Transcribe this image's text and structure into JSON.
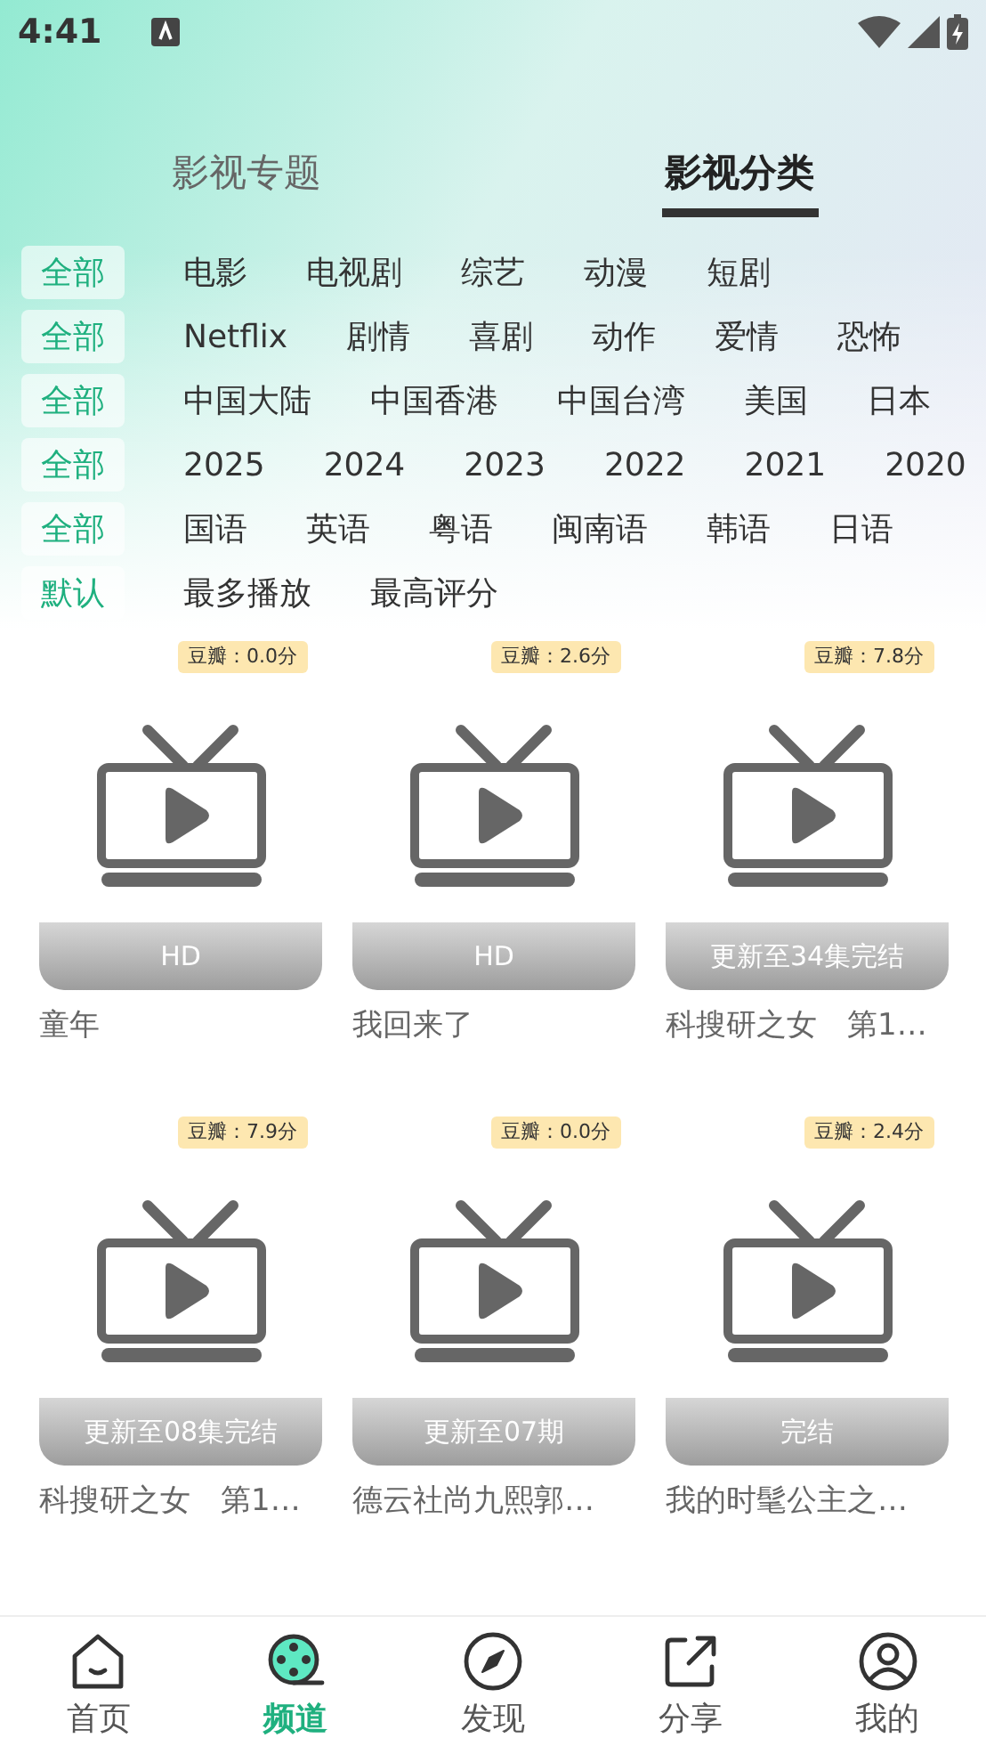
{
  "status_bar": {
    "time": "4:41"
  },
  "tabs": [
    {
      "label": "影视专题",
      "selected": false
    },
    {
      "label": "影视分类",
      "selected": true
    }
  ],
  "filters": [
    {
      "options": [
        {
          "label": "全部",
          "selected": true
        },
        {
          "label": "电影",
          "selected": false
        },
        {
          "label": "电视剧",
          "selected": false
        },
        {
          "label": "综艺",
          "selected": false
        },
        {
          "label": "动漫",
          "selected": false
        },
        {
          "label": "短剧",
          "selected": false
        }
      ]
    },
    {
      "options": [
        {
          "label": "全部",
          "selected": true
        },
        {
          "label": "Netflix",
          "selected": false
        },
        {
          "label": "剧情",
          "selected": false
        },
        {
          "label": "喜剧",
          "selected": false
        },
        {
          "label": "动作",
          "selected": false
        },
        {
          "label": "爱情",
          "selected": false
        },
        {
          "label": "恐怖",
          "selected": false
        }
      ]
    },
    {
      "options": [
        {
          "label": "全部",
          "selected": true
        },
        {
          "label": "中国大陆",
          "selected": false
        },
        {
          "label": "中国香港",
          "selected": false
        },
        {
          "label": "中国台湾",
          "selected": false
        },
        {
          "label": "美国",
          "selected": false
        },
        {
          "label": "日本",
          "selected": false
        }
      ]
    },
    {
      "options": [
        {
          "label": "全部",
          "selected": true
        },
        {
          "label": "2025",
          "selected": false
        },
        {
          "label": "2024",
          "selected": false
        },
        {
          "label": "2023",
          "selected": false
        },
        {
          "label": "2022",
          "selected": false
        },
        {
          "label": "2021",
          "selected": false
        },
        {
          "label": "2020",
          "selected": false
        }
      ]
    },
    {
      "options": [
        {
          "label": "全部",
          "selected": true
        },
        {
          "label": "国语",
          "selected": false
        },
        {
          "label": "英语",
          "selected": false
        },
        {
          "label": "粤语",
          "selected": false
        },
        {
          "label": "闽南语",
          "selected": false
        },
        {
          "label": "韩语",
          "selected": false
        },
        {
          "label": "日语",
          "selected": false
        }
      ]
    },
    {
      "options": [
        {
          "label": "默认",
          "selected": true
        },
        {
          "label": "最多播放",
          "selected": false
        },
        {
          "label": "最高评分",
          "selected": false
        }
      ]
    }
  ],
  "videos": [
    {
      "rating": "豆瓣：0.0分",
      "status": "HD",
      "title": "童年"
    },
    {
      "rating": "豆瓣：2.6分",
      "status": "HD",
      "title": "我回来了"
    },
    {
      "rating": "豆瓣：7.8分",
      "status": "更新至34集完结",
      "title": "科搜研之女　第1…"
    },
    {
      "rating": "豆瓣：7.9分",
      "status": "更新至08集完结",
      "title": "科搜研之女　第1…"
    },
    {
      "rating": "豆瓣：0.0分",
      "status": "更新至07期",
      "title": "德云社尚九熙郭…"
    },
    {
      "rating": "豆瓣：2.4分",
      "status": "完结",
      "title": "我的时髦公主之…"
    }
  ],
  "bottom_nav": [
    {
      "label": "首页",
      "selected": false,
      "kind": "home"
    },
    {
      "label": "频道",
      "selected": true,
      "kind": "channel"
    },
    {
      "label": "发现",
      "selected": false,
      "kind": "discover"
    },
    {
      "label": "分享",
      "selected": false,
      "kind": "share"
    },
    {
      "label": "我的",
      "selected": false,
      "kind": "profile"
    }
  ]
}
